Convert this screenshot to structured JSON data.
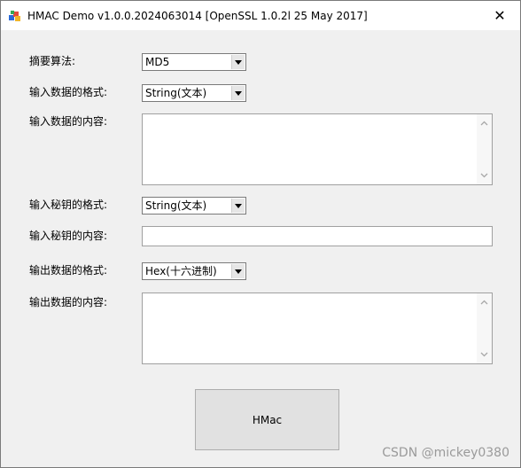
{
  "window": {
    "title": "HMAC Demo v1.0.0.2024063014 [OpenSSL 1.0.2l  25 May 2017]",
    "close_glyph": "✕",
    "app_icon": "app-icon"
  },
  "form": {
    "digest_algorithm": {
      "label": "摘要算法:",
      "value": "MD5"
    },
    "input_data_format": {
      "label": "输入数据的格式:",
      "value": "String(文本)"
    },
    "input_data_content": {
      "label": "输入数据的内容:",
      "value": ""
    },
    "key_format": {
      "label": "输入秘钥的格式:",
      "value": "String(文本)"
    },
    "key_content": {
      "label": "输入秘钥的内容:",
      "value": ""
    },
    "output_data_format": {
      "label": "输出数据的格式:",
      "value": "Hex(十六进制)"
    },
    "output_data_content": {
      "label": "输出数据的内容:",
      "value": ""
    }
  },
  "buttons": {
    "hmac_label": "HMac"
  },
  "watermark": "CSDN @mickey0380"
}
